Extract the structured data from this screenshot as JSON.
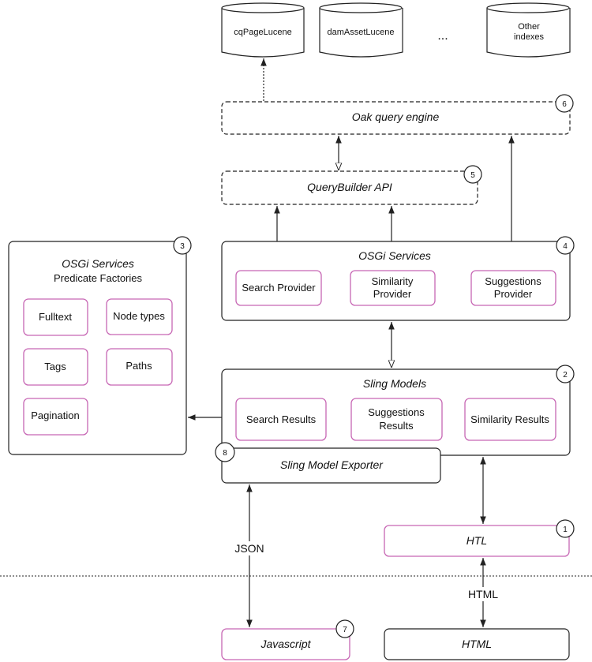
{
  "indexes": [
    "cqPageLucene",
    "damAssetLucene",
    "...",
    "Other",
    "indexes"
  ],
  "oak": {
    "label": "Oak query engine",
    "num": "6"
  },
  "querybuilder": {
    "label": "QueryBuilder API",
    "num": "5"
  },
  "osgi_right": {
    "title": "OSGi Services",
    "num": "4",
    "items": [
      "Search Provider",
      "Similarity",
      "Provider",
      "Suggestions",
      "Provider"
    ]
  },
  "osgi_left": {
    "title": "OSGi Services",
    "subtitle": "Predicate Factories",
    "num": "3",
    "items": [
      "Fulltext",
      "Node types",
      "Tags",
      "Paths",
      "Pagination"
    ]
  },
  "sling_models": {
    "title": "Sling Models",
    "num": "2",
    "items": [
      "Search Results",
      "Suggestions",
      "Results",
      "Similarity Results"
    ]
  },
  "exporter": {
    "label": "Sling Model Exporter",
    "num": "8"
  },
  "htl": {
    "label": "HTL",
    "num": "1"
  },
  "javascript": {
    "label": "Javascript",
    "num": "7"
  },
  "html_box": {
    "label": "HTML"
  },
  "edge_labels": {
    "json": "JSON",
    "html": "HTML"
  },
  "colors": {
    "accent_border": "#c766b4",
    "line": "#222222"
  }
}
